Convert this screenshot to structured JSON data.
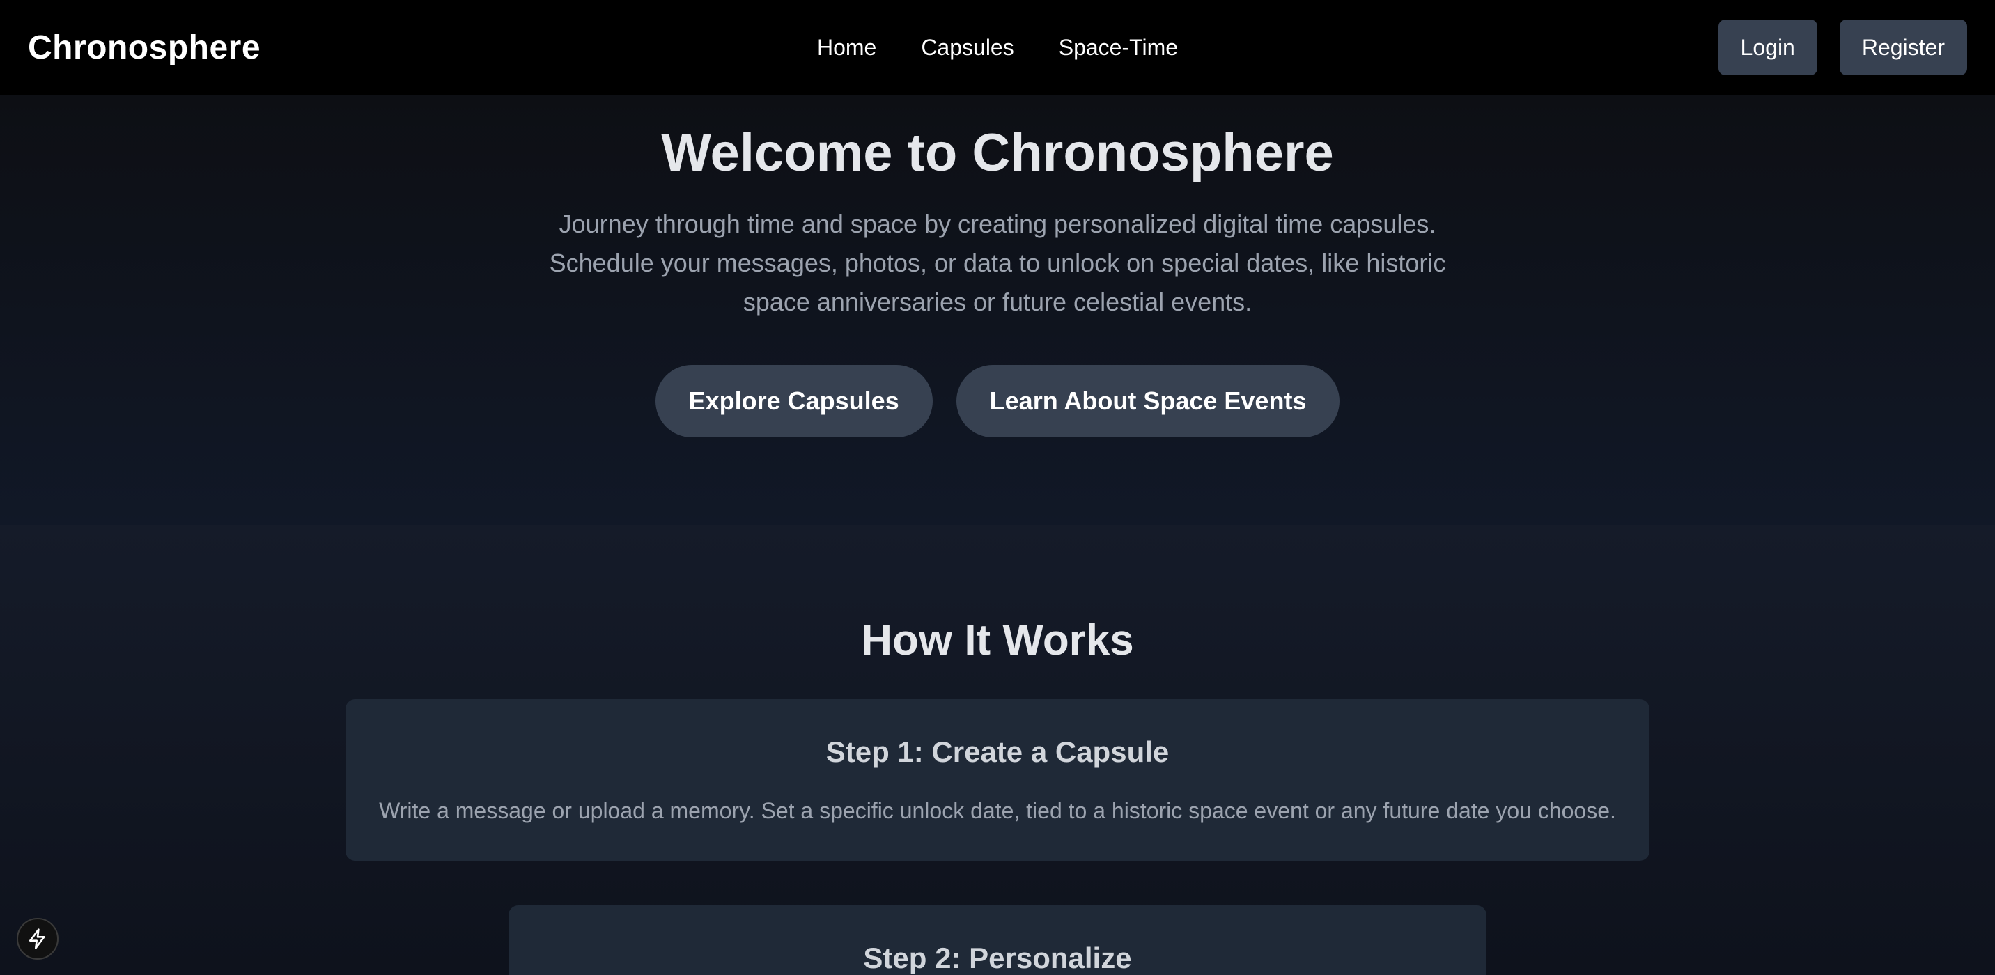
{
  "header": {
    "brand": "Chronosphere",
    "nav": [
      {
        "label": "Home"
      },
      {
        "label": "Capsules"
      },
      {
        "label": "Space-Time"
      }
    ],
    "login_label": "Login",
    "register_label": "Register"
  },
  "hero": {
    "title": "Welcome to Chronosphere",
    "description": "Journey through time and space by creating personalized digital time capsules. Schedule your messages, photos, or data to unlock on special dates, like historic space anniversaries or future celestial events.",
    "primary_button": "Explore Capsules",
    "secondary_button": "Learn About Space Events"
  },
  "how_it_works": {
    "title": "How It Works",
    "steps": [
      {
        "title": "Step 1: Create a Capsule",
        "description": "Write a message or upload a memory. Set a specific unlock date, tied to a historic space event or any future date you choose."
      },
      {
        "title": "Step 2: Personalize"
      }
    ]
  },
  "floating_icon": "lightning-bolt-icon"
}
